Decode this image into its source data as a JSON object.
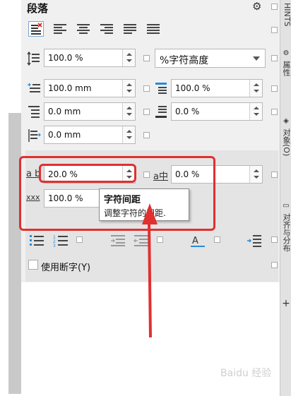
{
  "panel": {
    "title": "段落",
    "gear_icon": "gear-icon"
  },
  "alignment": {
    "buttons": [
      {
        "name": "no-align",
        "icon": "align-none-icon",
        "active": true
      },
      {
        "name": "align-left",
        "icon": "align-left-icon"
      },
      {
        "name": "align-center",
        "icon": "align-center-icon"
      },
      {
        "name": "align-right",
        "icon": "align-right-icon"
      },
      {
        "name": "justify",
        "icon": "justify-icon"
      },
      {
        "name": "force-justify",
        "icon": "force-justify-icon"
      }
    ]
  },
  "line_spacing": {
    "value": "100.0 %",
    "unit_select": "%字符高度"
  },
  "indents": {
    "first_line": "100.0 mm",
    "before_paragraph": "100.0 %",
    "left": "0.0 mm",
    "after_paragraph": "0.0 %",
    "right": "0.0 mm"
  },
  "character_spacing": {
    "char_value": "20.0 %",
    "char_label": "a b",
    "language_value": "0.0 %",
    "language_label": "a中",
    "word_value": "100.0 %",
    "word_label": "xxx"
  },
  "tooltip": {
    "title": "字符间距",
    "description": "调整字符的间距."
  },
  "hyphenation": {
    "label": "使用断字(Y)"
  },
  "right_tabs": {
    "tab1": "HINTS",
    "tab2": "属性",
    "tab3": "对象(O)",
    "tab4": "对齐与分布"
  },
  "watermark": "Baidu 经验",
  "colors": {
    "highlight": "#e03030",
    "accent_blue": "#2a8ad8"
  }
}
